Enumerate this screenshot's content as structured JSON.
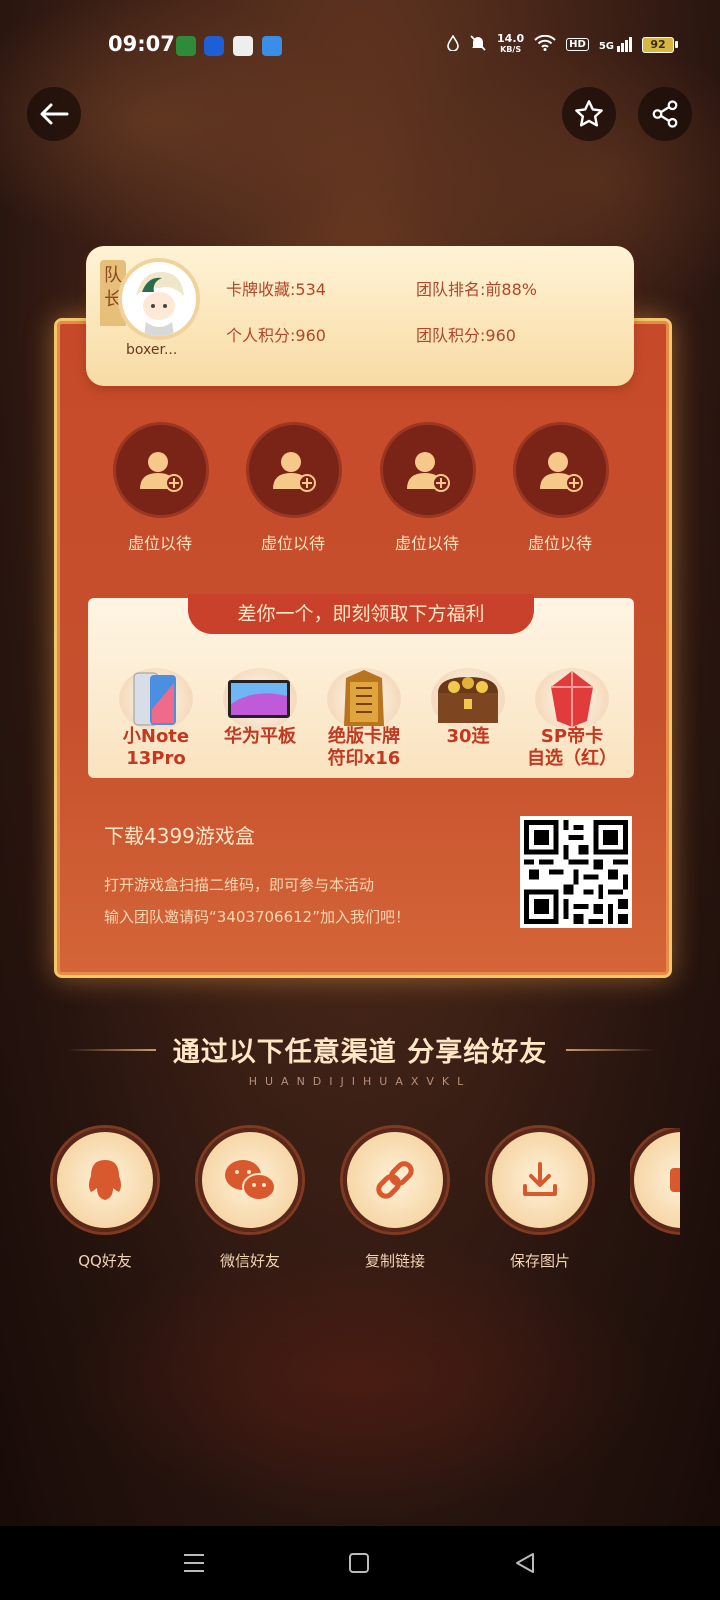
{
  "status_bar": {
    "time": "09:07",
    "network_speed_value": "14.0",
    "network_speed_unit": "KB/S",
    "hd": "HD",
    "signal": "5G",
    "battery": "92"
  },
  "header": {
    "back_icon": "arrow-left-icon",
    "favorite_icon": "star-icon",
    "share_icon": "share-icon"
  },
  "team_card": {
    "captain_tag": "队长",
    "username": "boxer...",
    "stats": {
      "cards_collected": "卡牌收藏:534",
      "team_rank": "团队排名:前88%",
      "personal_points": "个人积分:960",
      "team_points": "团队积分:960"
    },
    "empty_slots": [
      "虚位以待",
      "虚位以待",
      "虚位以待",
      "虚位以待"
    ],
    "benefits": {
      "title": "差你一个，即刻领取下方福利",
      "rewards": [
        {
          "line1": "小Note",
          "line2": "13Pro"
        },
        {
          "line1": "华为平板",
          "line2": ""
        },
        {
          "line1": "绝版卡牌",
          "line2": "符印x16"
        },
        {
          "line1": "30连",
          "line2": ""
        },
        {
          "line1": "SP帝卡",
          "line2": "自选（红）"
        }
      ]
    },
    "download": {
      "title": "下载4399游戏盒",
      "line1": "打开游戏盒扫描二维码，即可参与本活动",
      "line2": "输入团队邀请码“3403706612”加入我们吧！"
    }
  },
  "share": {
    "heading": "通过以下任意渠道 分享给好友",
    "subheading": "HUANDIJIHUAXVKL",
    "channels": [
      {
        "label": "QQ好友",
        "icon": "qq-icon"
      },
      {
        "label": "微信好友",
        "icon": "wechat-icon"
      },
      {
        "label": "复制链接",
        "icon": "link-icon"
      },
      {
        "label": "保存图片",
        "icon": "download-icon"
      },
      {
        "label": "",
        "icon": "more-icon"
      }
    ]
  },
  "colors": {
    "card_red": "#c64a2a",
    "panel_cream": "#fff3d6",
    "gold_border": "#f2c66a"
  }
}
